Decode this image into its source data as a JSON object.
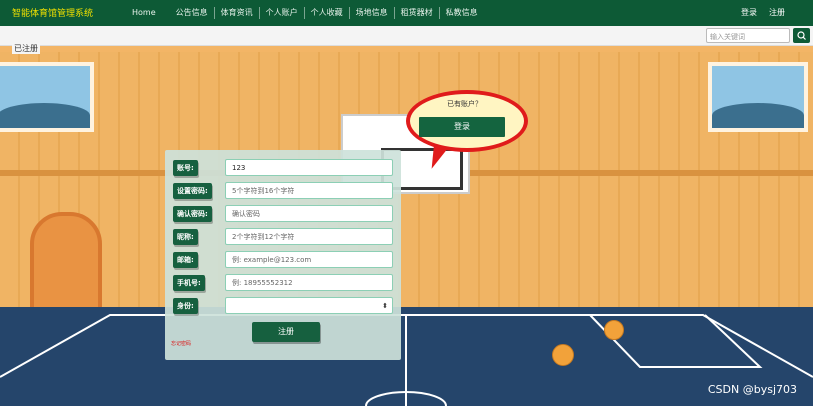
{
  "header": {
    "brand": "智能体育馆管理系统",
    "nav": [
      "Home",
      "公告信息",
      "体育资讯",
      "个人账户",
      "个人收藏",
      "场地信息",
      "租赁器材",
      "私教信息"
    ],
    "right_links": [
      "登录",
      "注册"
    ]
  },
  "search": {
    "placeholder": "输入关键词"
  },
  "page_tag": "已注册",
  "bubble": {
    "question": "已有账户？",
    "login_label": "登录"
  },
  "form": {
    "fields": [
      {
        "label": "账号:",
        "value": "123",
        "placeholder": ""
      },
      {
        "label": "设置密码:",
        "value": "",
        "placeholder": "5个字符到16个字符"
      },
      {
        "label": "确认密码:",
        "value": "",
        "placeholder": "确认密码"
      },
      {
        "label": "昵称:",
        "value": "",
        "placeholder": "2个字符到12个字符"
      },
      {
        "label": "邮箱:",
        "value": "",
        "placeholder": "例: example@123.com"
      },
      {
        "label": "手机号:",
        "value": "",
        "placeholder": "例: 18955552312"
      },
      {
        "label": "身份:",
        "value": "",
        "placeholder": ""
      }
    ],
    "register_label": "注册",
    "forgot_label": "忘记密码"
  },
  "watermark": "CSDN @bysj703",
  "colors": {
    "primary": "#16603f",
    "bubble_border": "#e01b1b",
    "brand_text": "#f0e000"
  }
}
